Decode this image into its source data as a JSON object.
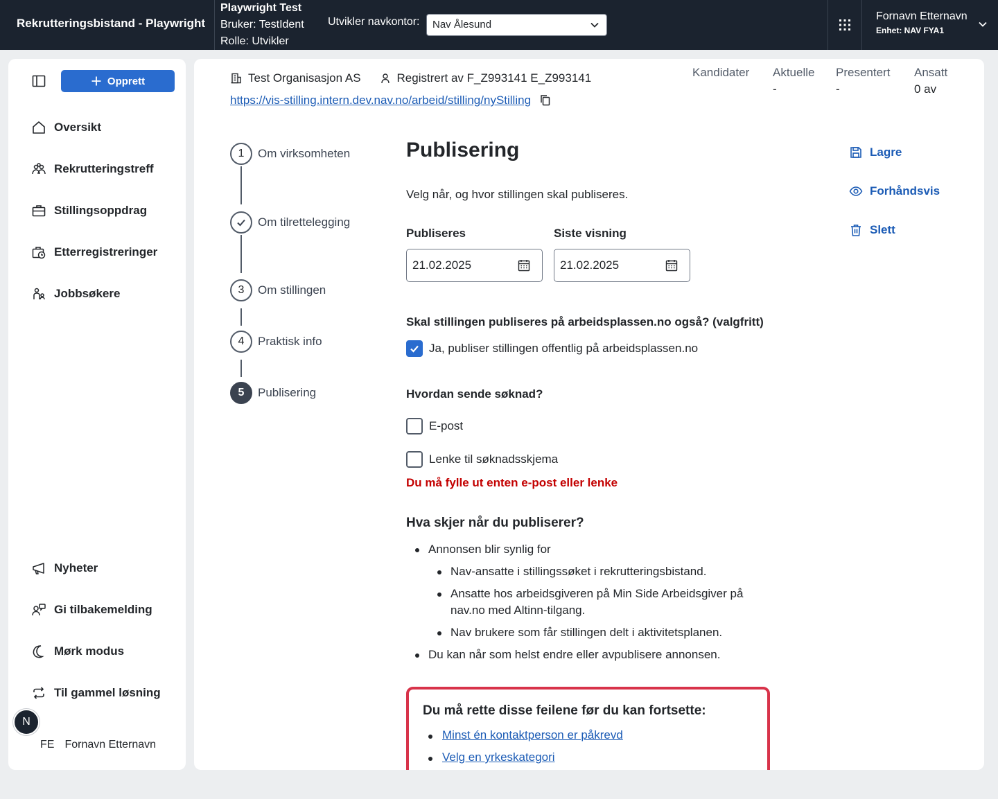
{
  "topbar": {
    "app_title": "Rekrutteringsbistand - Playwright",
    "dev_title": "Playwright Test",
    "dev_user": "Bruker: TestIdent",
    "dev_role": "Rolle: Utvikler",
    "navkontor_label": "Utvikler navkontor:",
    "navkontor_value": "Nav Ålesund",
    "user_name": "Fornavn Etternavn",
    "user_unit": "Enhet: NAV FYA1"
  },
  "sidebar": {
    "create_label": "Opprett",
    "items": [
      {
        "label": "Oversikt",
        "icon": "home-icon"
      },
      {
        "label": "Rekrutteringstreff",
        "icon": "people-icon"
      },
      {
        "label": "Stillingsoppdrag",
        "icon": "briefcase-icon"
      },
      {
        "label": "Etterregistreringer",
        "icon": "briefcase-clock-icon"
      },
      {
        "label": "Jobbsøkere",
        "icon": "person-icon"
      }
    ],
    "bottom_items": [
      {
        "label": "Nyheter",
        "icon": "megaphone-icon"
      },
      {
        "label": "Gi tilbakemelding",
        "icon": "feedback-icon"
      },
      {
        "label": "Mørk modus",
        "icon": "moon-icon"
      },
      {
        "label": "Til gammel løsning",
        "icon": "arrows-circle-icon"
      }
    ],
    "badge": "N",
    "user_initials": "FE",
    "user_name": "Fornavn Etternavn"
  },
  "header": {
    "organization": "Test Organisasjon AS",
    "registered_by": "Registrert av F_Z993141 E_Z993141",
    "url": "https://vis-stilling.intern.dev.nav.no/arbeid/stilling/nyStilling",
    "stats": [
      {
        "label": "Kandidater",
        "value": ""
      },
      {
        "label": "Aktuelle",
        "value": "-"
      },
      {
        "label": "Presentert",
        "value": "-"
      },
      {
        "label": "Ansatt",
        "value": "0 av"
      }
    ]
  },
  "stepper": [
    {
      "number": "1",
      "label": "Om virksomheten"
    },
    {
      "number": "",
      "label": "Om tilrettelegging",
      "done": true
    },
    {
      "number": "3",
      "label": "Om stillingen"
    },
    {
      "number": "4",
      "label": "Praktisk info"
    },
    {
      "number": "5",
      "label": "Publisering",
      "active": true
    }
  ],
  "form": {
    "heading": "Publisering",
    "intro": "Velg når, og hvor stillingen skal publiseres.",
    "publish_label": "Publiseres",
    "publish_value": "21.02.2025",
    "last_label": "Siste visning",
    "last_value": "21.02.2025",
    "public_question": "Skal stillingen publiseres på arbeidsplassen.no også? (valgfritt)",
    "public_option": "Ja, publiser stillingen offentlig på arbeidsplassen.no",
    "public_checked": true,
    "apply_question": "Hvordan sende søknad?",
    "apply_email": "E-post",
    "apply_link": "Lenke til søknadsskjema",
    "apply_error": "Du må fylle ut enten e-post eller lenke",
    "info_heading": "Hva skjer når du publiserer?",
    "info_main": "Annonsen blir synlig for",
    "info_sub": [
      "Nav-ansatte i stillingssøket i rekrutteringsbistand.",
      "Ansatte hos arbeidsgiveren på Min Side Arbeidsgiver på nav.no med Altinn-tilgang.",
      "Nav brukere som får stillingen delt i aktivitetsplanen."
    ],
    "info_last": "Du kan når som helst endre eller avpublisere annonsen.",
    "error_summary_title": "Du må rette disse feilene før du kan fortsette:",
    "error_summary_items": [
      "Minst én kontaktperson er påkrevd",
      "Velg en yrkeskategori"
    ]
  },
  "actions": {
    "save": "Lagre",
    "preview": "Forhåndsvis",
    "delete": "Slett"
  },
  "colors": {
    "topbar": "#1b232f",
    "accent": "#2a6ccf",
    "link": "#1b5bb5",
    "error": "#c30000",
    "error_border": "#d8334a"
  }
}
